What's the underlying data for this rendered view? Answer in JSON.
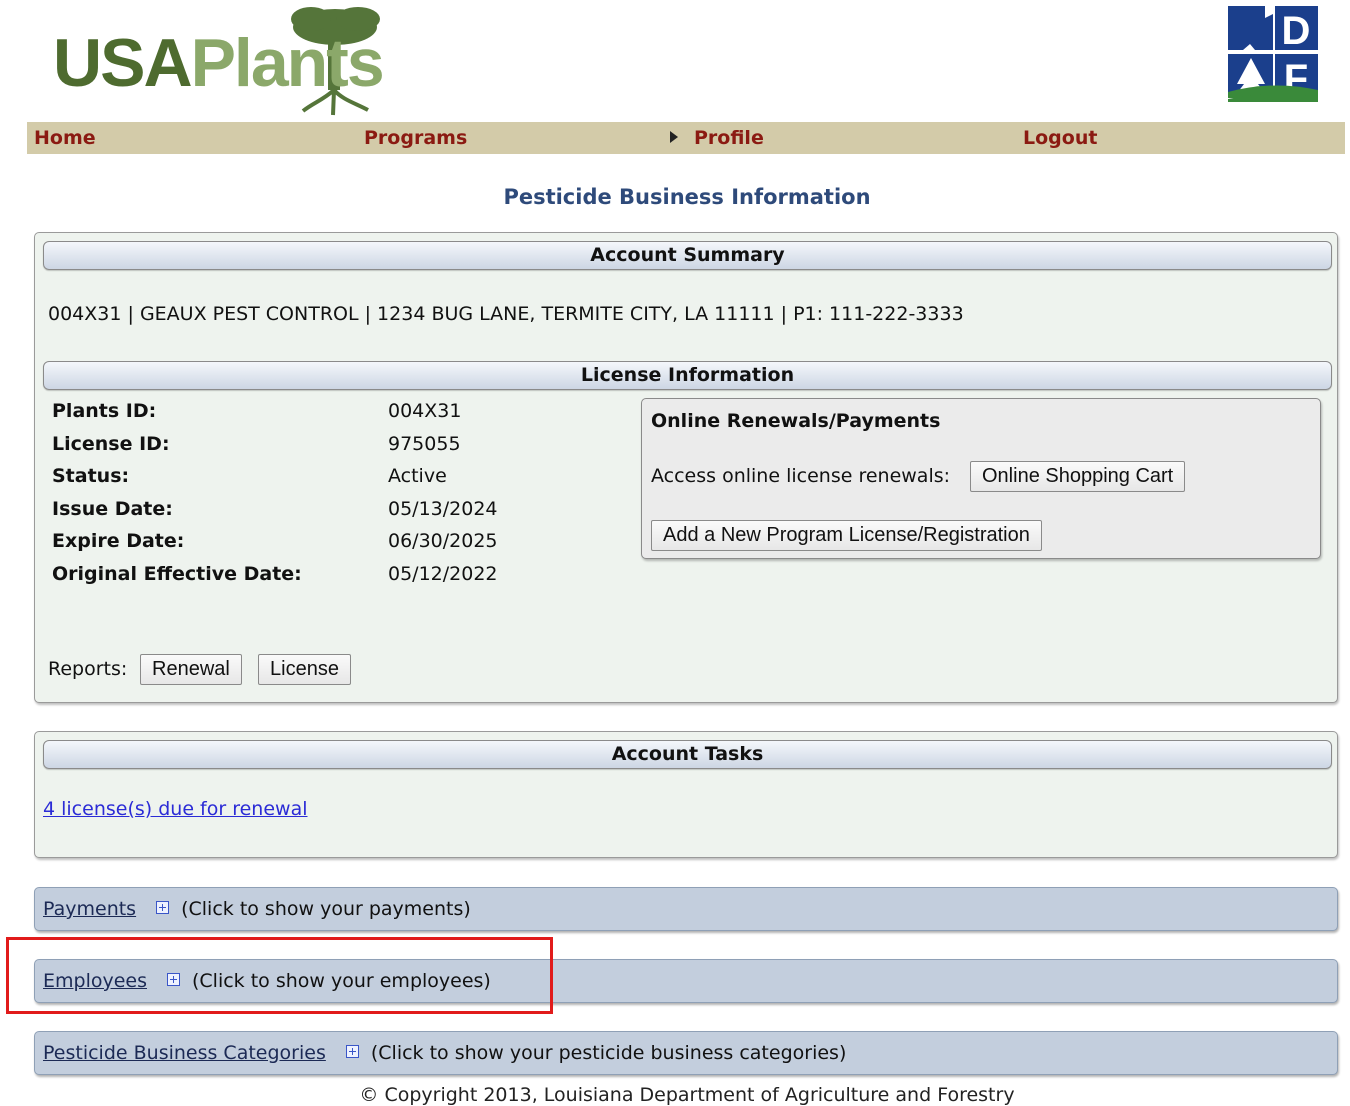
{
  "header": {
    "logo_part1": "USA",
    "logo_part2": "Plants",
    "agency_logo_text": "LDAF"
  },
  "nav": {
    "home": "Home",
    "programs": "Programs",
    "profile": "Profile",
    "logout": "Logout"
  },
  "page_title": "Pesticide Business Information",
  "account_summary": {
    "heading": "Account Summary",
    "line": "004X31 | GEAUX PEST CONTROL | 1234 BUG LANE, TERMITE CITY, LA 11111 | P1: 111-222-3333"
  },
  "license_info": {
    "heading": "License Information",
    "fields": [
      {
        "label": "Plants ID:",
        "value": "004X31"
      },
      {
        "label": "License ID:",
        "value": "975055"
      },
      {
        "label": "Status:",
        "value": "Active"
      },
      {
        "label": "Issue Date:",
        "value": "05/13/2024"
      },
      {
        "label": "Expire Date:",
        "value": "06/30/2025"
      },
      {
        "label": "Original Effective Date:",
        "value": "05/12/2022"
      }
    ],
    "reports_label": "Reports:",
    "renewal_button": "Renewal",
    "license_button": "License"
  },
  "online_renewals": {
    "heading": "Online Renewals/Payments",
    "access_label": "Access online license renewals:",
    "cart_button": "Online Shopping Cart",
    "add_button": "Add a New Program License/Registration"
  },
  "account_tasks": {
    "heading": "Account Tasks",
    "renewal_link": "4 license(s) due for renewal"
  },
  "sections": {
    "payments": {
      "title": "Payments",
      "hint": "(Click to show your payments)"
    },
    "employees": {
      "title": "Employees",
      "hint": "(Click to show your employees)"
    },
    "categories": {
      "title": "Pesticide Business Categories",
      "hint": "(Click to show your pesticide business categories)"
    }
  },
  "footer": {
    "copyright": "© Copyright 2013, Louisiana Department of Agriculture and Forestry"
  },
  "colors": {
    "nav_bg": "#d3cba9",
    "nav_text": "#8b1a12",
    "title": "#2e4a7a",
    "highlight": "#e11b1b"
  }
}
